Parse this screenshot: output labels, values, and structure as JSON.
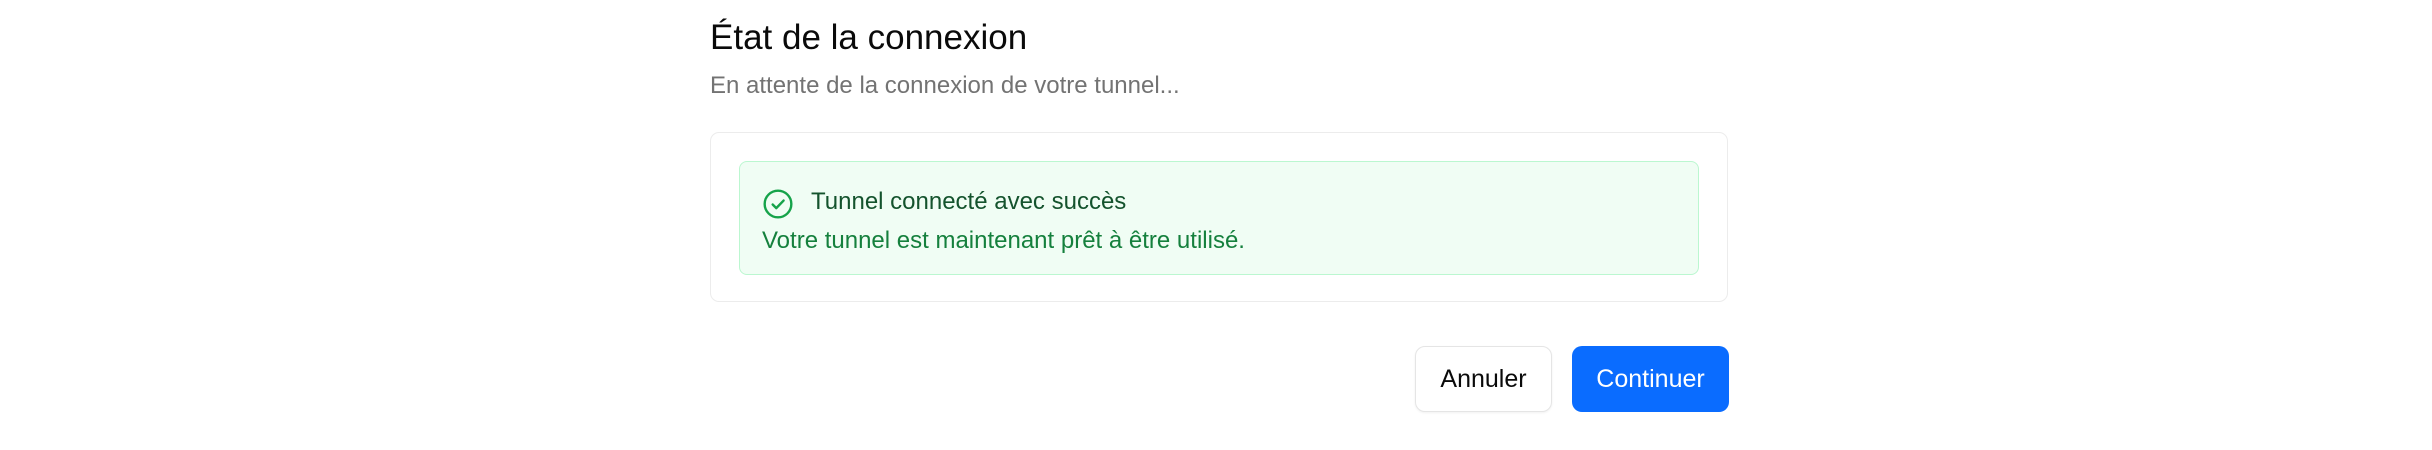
{
  "dialog": {
    "title": "État de la connexion",
    "subtitle": "En attente de la connexion de votre tunnel..."
  },
  "alert": {
    "icon": "check-circle-icon",
    "title": "Tunnel connecté avec succès",
    "description": "Votre tunnel est maintenant prêt à être utilisé.",
    "status": "success",
    "colors": {
      "background": "#f0fdf4",
      "border": "#bbf7d0",
      "icon": "#16a34a",
      "title": "#14532d",
      "text": "#15803d"
    }
  },
  "actions": {
    "cancel_label": "Annuler",
    "continue_label": "Continuer",
    "primary_color": "#0a6cff"
  }
}
